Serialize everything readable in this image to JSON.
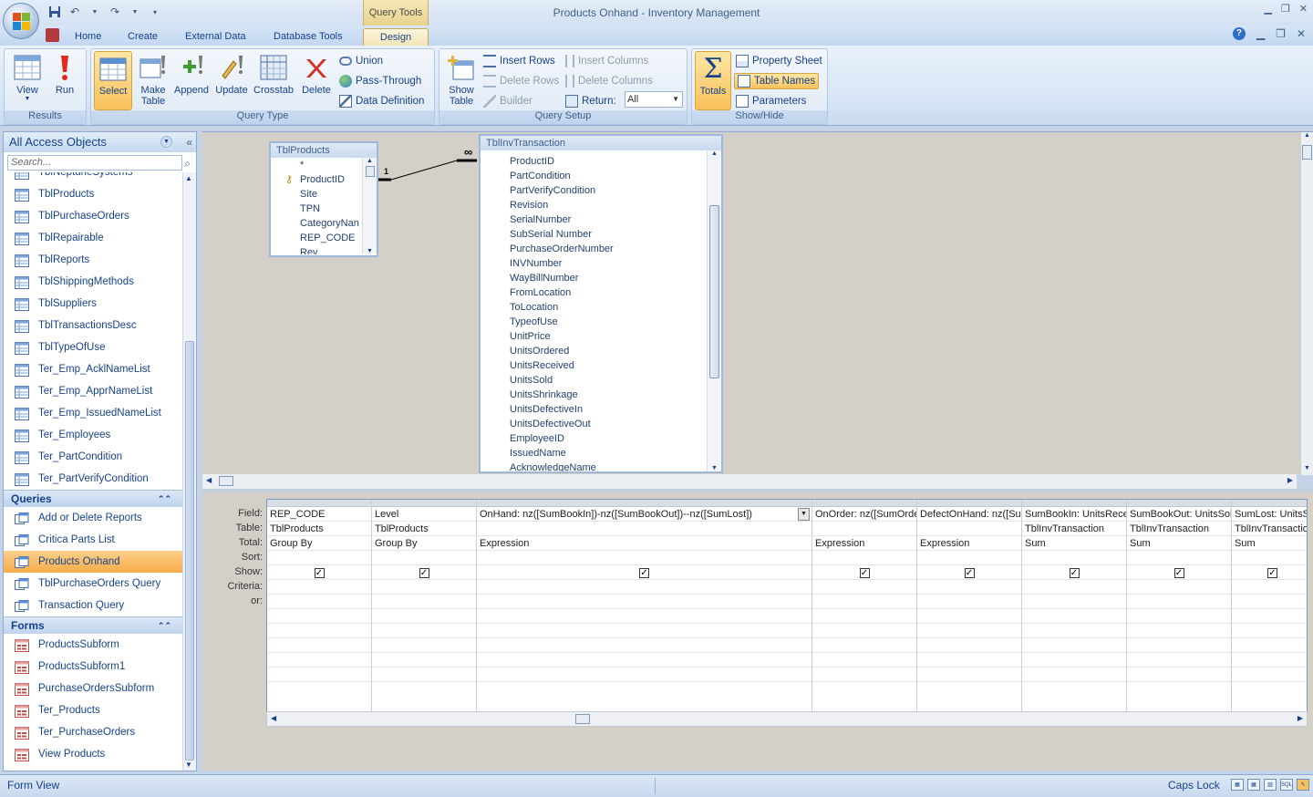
{
  "window": {
    "title": "Products Onhand - Inventory Management",
    "context_tab_label": "Query Tools"
  },
  "ribbon_tabs": [
    "Home",
    "Create",
    "External Data",
    "Database Tools",
    "Design"
  ],
  "ribbon": {
    "results": {
      "label": "Results",
      "view": "View",
      "run": "Run"
    },
    "query_type": {
      "label": "Query Type",
      "select": "Select",
      "make_table": "Make\nTable",
      "append": "Append",
      "update": "Update",
      "crosstab": "Crosstab",
      "delete": "Delete",
      "union": "Union",
      "pass_through": "Pass-Through",
      "data_definition": "Data Definition"
    },
    "query_setup": {
      "label": "Query Setup",
      "show_table": "Show\nTable",
      "insert_rows": "Insert Rows",
      "delete_rows": "Delete Rows",
      "builder": "Builder",
      "insert_columns": "Insert Columns",
      "delete_columns": "Delete Columns",
      "return_label": "Return:",
      "return_value": "All"
    },
    "show_hide": {
      "label": "Show/Hide",
      "totals": "Totals",
      "property_sheet": "Property Sheet",
      "table_names": "Table Names",
      "parameters": "Parameters"
    }
  },
  "nav": {
    "header": "All Access Objects",
    "search_placeholder": "Search...",
    "tables": [
      "TblNeptuneSystems",
      "TblProducts",
      "TblPurchaseOrders",
      "TblRepairable",
      "TblReports",
      "TblShippingMethods",
      "TblSuppliers",
      "TblTransactionsDesc",
      "TblTypeOfUse",
      "Ter_Emp_AcklNameList",
      "Ter_Emp_ApprNameList",
      "Ter_Emp_IssuedNameList",
      "Ter_Employees",
      "Ter_PartCondition",
      "Ter_PartVerifyCondition"
    ],
    "queries_header": "Queries",
    "queries": [
      "Add or Delete Reports",
      "Critica Parts List",
      "Products Onhand",
      "TblPurchaseOrders Query",
      "Transaction Query"
    ],
    "selected_query": "Products Onhand",
    "forms_header": "Forms",
    "forms": [
      "ProductsSubform",
      "ProductsSubform1",
      "PurchaseOrdersSubform",
      "Ter_Products",
      "Ter_PurchaseOrders",
      "View Products"
    ]
  },
  "designer": {
    "table1": {
      "title": "TblProducts",
      "fields": [
        "*",
        "ProductID",
        "Site",
        "TPN",
        "CategoryNan",
        "REP_CODE",
        "Rev"
      ]
    },
    "table2": {
      "title": "TblInvTransaction",
      "fields": [
        "ProductID",
        "PartCondition",
        "PartVerifyCondition",
        "Revision",
        "SerialNumber",
        "SubSerial Number",
        "PurchaseOrderNumber",
        "INVNumber",
        "WayBillNumber",
        "FromLocation",
        "ToLocation",
        "TypeofUse",
        "UnitPrice",
        "UnitsOrdered",
        "UnitsReceived",
        "UnitsSold",
        "UnitsShrinkage",
        "UnitsDefectiveIn",
        "UnitsDefectiveOut",
        "EmployeeID",
        "IssuedName",
        "AcknowledgeName"
      ]
    },
    "join_one": "1",
    "join_many": "∞"
  },
  "grid": {
    "row_labels": [
      "Field:",
      "Table:",
      "Total:",
      "Sort:",
      "Show:",
      "Criteria:",
      "or:"
    ],
    "columns": [
      {
        "field": "REP_CODE",
        "table": "TblProducts",
        "total": "Group By",
        "show": true
      },
      {
        "field": "Level",
        "table": "TblProducts",
        "total": "Group By",
        "show": true
      },
      {
        "field": "OnHand: nz([SumBookIn])-nz([SumBookOut])--nz([SumLost])",
        "table": "",
        "total": "Expression",
        "show": true
      },
      {
        "field": "OnOrder: nz([SumOrde",
        "table": "",
        "total": "Expression",
        "show": true
      },
      {
        "field": "DefectOnHand: nz([Su",
        "table": "",
        "total": "Expression",
        "show": true
      },
      {
        "field": "SumBookIn: UnitsRecei",
        "table": "TblInvTransaction",
        "total": "Sum",
        "show": true
      },
      {
        "field": "SumBookOut: UnitsSol",
        "table": "TblInvTransaction",
        "total": "Sum",
        "show": true
      },
      {
        "field": "SumLost: UnitsS",
        "table": "TblInvTransactio",
        "total": "Sum",
        "show": true
      }
    ]
  },
  "status": {
    "left": "Form View",
    "caps": "Caps Lock",
    "sql": "SQL"
  }
}
